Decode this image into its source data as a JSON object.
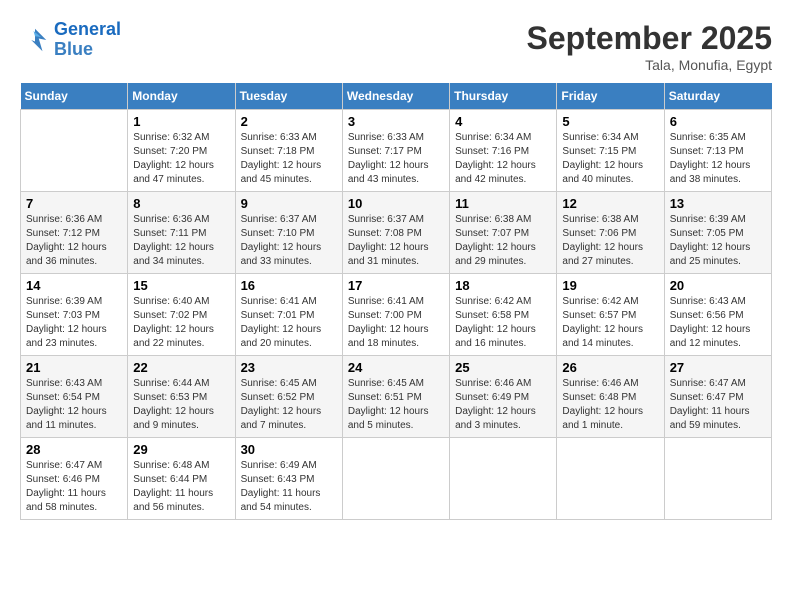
{
  "header": {
    "logo_line1": "General",
    "logo_line2": "Blue",
    "month": "September 2025",
    "location": "Tala, Monufia, Egypt"
  },
  "days_of_week": [
    "Sunday",
    "Monday",
    "Tuesday",
    "Wednesday",
    "Thursday",
    "Friday",
    "Saturday"
  ],
  "weeks": [
    [
      {
        "day": "",
        "info": ""
      },
      {
        "day": "1",
        "info": "Sunrise: 6:32 AM\nSunset: 7:20 PM\nDaylight: 12 hours\nand 47 minutes."
      },
      {
        "day": "2",
        "info": "Sunrise: 6:33 AM\nSunset: 7:18 PM\nDaylight: 12 hours\nand 45 minutes."
      },
      {
        "day": "3",
        "info": "Sunrise: 6:33 AM\nSunset: 7:17 PM\nDaylight: 12 hours\nand 43 minutes."
      },
      {
        "day": "4",
        "info": "Sunrise: 6:34 AM\nSunset: 7:16 PM\nDaylight: 12 hours\nand 42 minutes."
      },
      {
        "day": "5",
        "info": "Sunrise: 6:34 AM\nSunset: 7:15 PM\nDaylight: 12 hours\nand 40 minutes."
      },
      {
        "day": "6",
        "info": "Sunrise: 6:35 AM\nSunset: 7:13 PM\nDaylight: 12 hours\nand 38 minutes."
      }
    ],
    [
      {
        "day": "7",
        "info": "Sunrise: 6:36 AM\nSunset: 7:12 PM\nDaylight: 12 hours\nand 36 minutes."
      },
      {
        "day": "8",
        "info": "Sunrise: 6:36 AM\nSunset: 7:11 PM\nDaylight: 12 hours\nand 34 minutes."
      },
      {
        "day": "9",
        "info": "Sunrise: 6:37 AM\nSunset: 7:10 PM\nDaylight: 12 hours\nand 33 minutes."
      },
      {
        "day": "10",
        "info": "Sunrise: 6:37 AM\nSunset: 7:08 PM\nDaylight: 12 hours\nand 31 minutes."
      },
      {
        "day": "11",
        "info": "Sunrise: 6:38 AM\nSunset: 7:07 PM\nDaylight: 12 hours\nand 29 minutes."
      },
      {
        "day": "12",
        "info": "Sunrise: 6:38 AM\nSunset: 7:06 PM\nDaylight: 12 hours\nand 27 minutes."
      },
      {
        "day": "13",
        "info": "Sunrise: 6:39 AM\nSunset: 7:05 PM\nDaylight: 12 hours\nand 25 minutes."
      }
    ],
    [
      {
        "day": "14",
        "info": "Sunrise: 6:39 AM\nSunset: 7:03 PM\nDaylight: 12 hours\nand 23 minutes."
      },
      {
        "day": "15",
        "info": "Sunrise: 6:40 AM\nSunset: 7:02 PM\nDaylight: 12 hours\nand 22 minutes."
      },
      {
        "day": "16",
        "info": "Sunrise: 6:41 AM\nSunset: 7:01 PM\nDaylight: 12 hours\nand 20 minutes."
      },
      {
        "day": "17",
        "info": "Sunrise: 6:41 AM\nSunset: 7:00 PM\nDaylight: 12 hours\nand 18 minutes."
      },
      {
        "day": "18",
        "info": "Sunrise: 6:42 AM\nSunset: 6:58 PM\nDaylight: 12 hours\nand 16 minutes."
      },
      {
        "day": "19",
        "info": "Sunrise: 6:42 AM\nSunset: 6:57 PM\nDaylight: 12 hours\nand 14 minutes."
      },
      {
        "day": "20",
        "info": "Sunrise: 6:43 AM\nSunset: 6:56 PM\nDaylight: 12 hours\nand 12 minutes."
      }
    ],
    [
      {
        "day": "21",
        "info": "Sunrise: 6:43 AM\nSunset: 6:54 PM\nDaylight: 12 hours\nand 11 minutes."
      },
      {
        "day": "22",
        "info": "Sunrise: 6:44 AM\nSunset: 6:53 PM\nDaylight: 12 hours\nand 9 minutes."
      },
      {
        "day": "23",
        "info": "Sunrise: 6:45 AM\nSunset: 6:52 PM\nDaylight: 12 hours\nand 7 minutes."
      },
      {
        "day": "24",
        "info": "Sunrise: 6:45 AM\nSunset: 6:51 PM\nDaylight: 12 hours\nand 5 minutes."
      },
      {
        "day": "25",
        "info": "Sunrise: 6:46 AM\nSunset: 6:49 PM\nDaylight: 12 hours\nand 3 minutes."
      },
      {
        "day": "26",
        "info": "Sunrise: 6:46 AM\nSunset: 6:48 PM\nDaylight: 12 hours\nand 1 minute."
      },
      {
        "day": "27",
        "info": "Sunrise: 6:47 AM\nSunset: 6:47 PM\nDaylight: 11 hours\nand 59 minutes."
      }
    ],
    [
      {
        "day": "28",
        "info": "Sunrise: 6:47 AM\nSunset: 6:46 PM\nDaylight: 11 hours\nand 58 minutes."
      },
      {
        "day": "29",
        "info": "Sunrise: 6:48 AM\nSunset: 6:44 PM\nDaylight: 11 hours\nand 56 minutes."
      },
      {
        "day": "30",
        "info": "Sunrise: 6:49 AM\nSunset: 6:43 PM\nDaylight: 11 hours\nand 54 minutes."
      },
      {
        "day": "",
        "info": ""
      },
      {
        "day": "",
        "info": ""
      },
      {
        "day": "",
        "info": ""
      },
      {
        "day": "",
        "info": ""
      }
    ]
  ]
}
